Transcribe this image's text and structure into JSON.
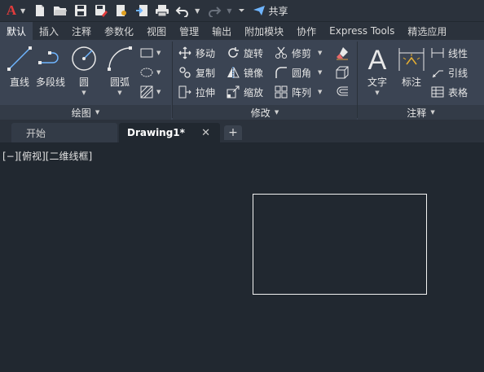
{
  "quick_access": {
    "share_label": "共享"
  },
  "ribbon_tabs": [
    {
      "label": "默认",
      "active": true
    },
    {
      "label": "插入"
    },
    {
      "label": "注释"
    },
    {
      "label": "参数化"
    },
    {
      "label": "视图"
    },
    {
      "label": "管理"
    },
    {
      "label": "输出"
    },
    {
      "label": "附加模块"
    },
    {
      "label": "协作"
    },
    {
      "label": "Express Tools"
    },
    {
      "label": "精选应用"
    }
  ],
  "draw_panel": {
    "title": "绘图",
    "tools": {
      "line": "直线",
      "polyline": "多段线",
      "circle": "圆",
      "arc": "圆弧"
    }
  },
  "modify_panel": {
    "title": "修改",
    "tools": {
      "move": "移动",
      "rotate": "旋转",
      "trim": "修剪",
      "copy": "复制",
      "mirror": "镜像",
      "fillet": "圆角",
      "stretch": "拉伸",
      "scale": "缩放",
      "array": "阵列"
    }
  },
  "annotation_panel": {
    "title": "注释",
    "tools": {
      "text": "文字",
      "dimension": "标注",
      "linear": "线性",
      "leader": "引线",
      "table": "表格"
    }
  },
  "file_tabs": {
    "start": "开始",
    "drawing": "Drawing1*",
    "close": "✕",
    "new": "+"
  },
  "viewport": {
    "label": "[−][俯视][二维线框]"
  },
  "colors": {
    "accent": "#3b4453",
    "logo_red": "#e23c3c",
    "icon_blue": "#6fb5ff",
    "canvas": "#212830"
  }
}
